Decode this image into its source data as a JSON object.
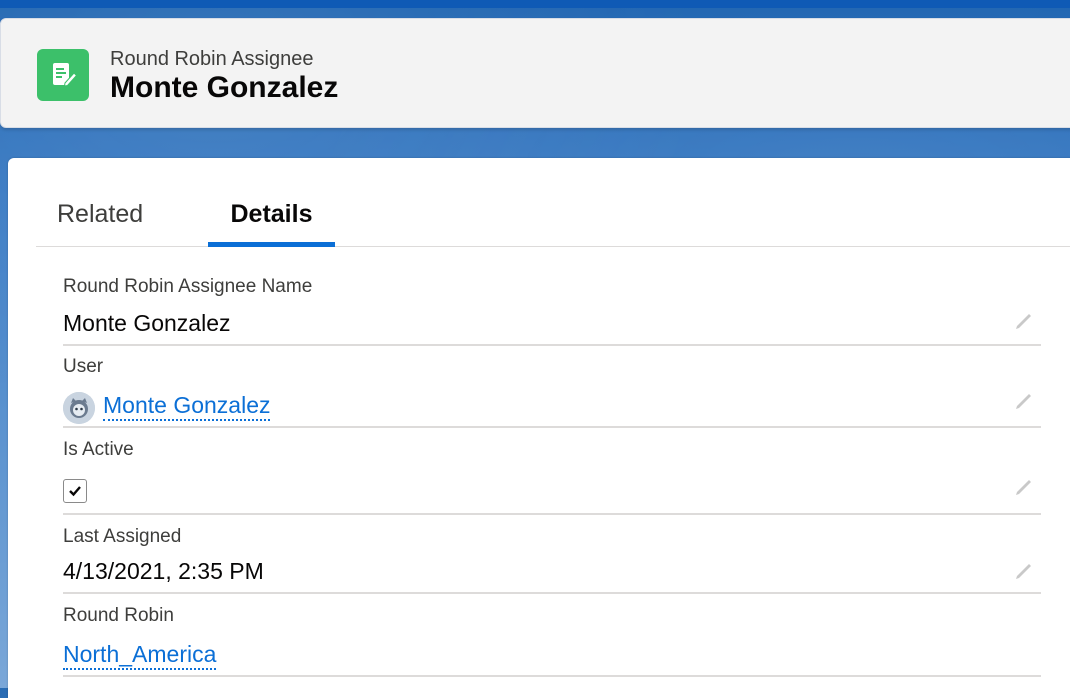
{
  "header": {
    "record_type": "Round Robin Assignee",
    "record_name": "Monte Gonzalez",
    "icon": "record-edit-icon",
    "icon_color": "#3cc06a"
  },
  "tabs": [
    {
      "label": "Related",
      "selected": false
    },
    {
      "label": "Details",
      "selected": true
    }
  ],
  "fields": {
    "name": {
      "label": "Round Robin Assignee Name",
      "value": "Monte Gonzalez"
    },
    "user": {
      "label": "User",
      "value": "Monte Gonzalez",
      "icon": "avatar-icon"
    },
    "is_active": {
      "label": "Is Active",
      "checked": true
    },
    "last_assigned": {
      "label": "Last Assigned",
      "value": "4/13/2021, 2:35 PM"
    },
    "round_robin": {
      "label": "Round Robin",
      "value": "North_America"
    }
  },
  "colors": {
    "link": "#0b6fd6",
    "tab_indicator": "#0b6fd6",
    "brand_bar": "#0f5ab5"
  }
}
